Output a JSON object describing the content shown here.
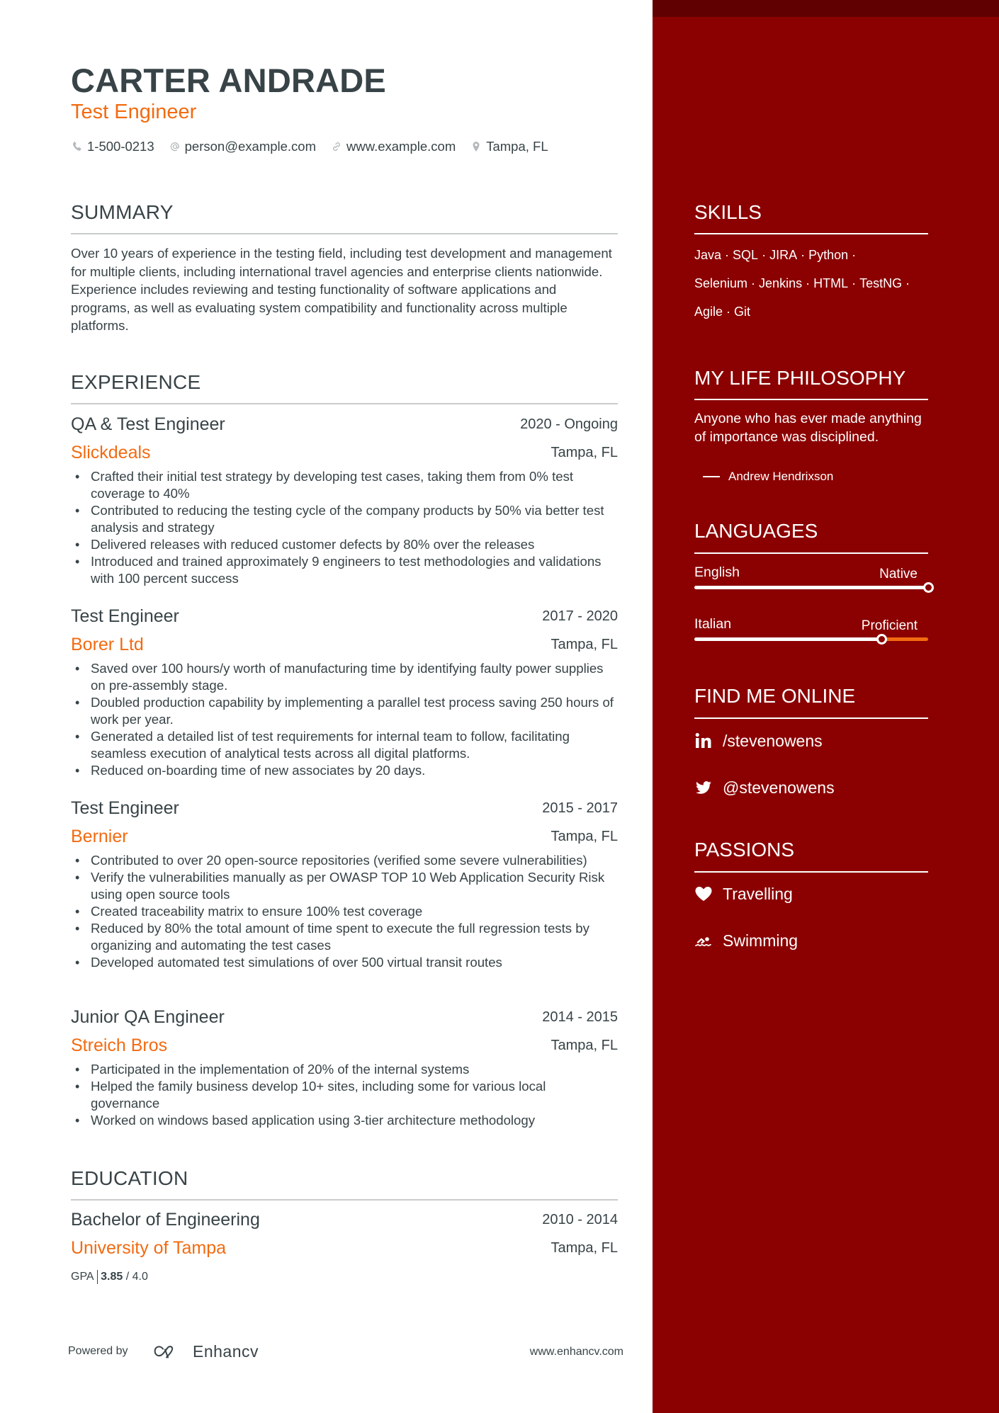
{
  "header": {
    "name": "CARTER ANDRADE",
    "title": "Test Engineer",
    "contacts": [
      {
        "icon": "phone-icon",
        "text": "1-500-0213"
      },
      {
        "icon": "at-icon",
        "text": "person@example.com"
      },
      {
        "icon": "link-icon",
        "text": "www.example.com"
      },
      {
        "icon": "location-pin-icon",
        "text": "Tampa, FL"
      }
    ]
  },
  "summary": {
    "heading": "SUMMARY",
    "text": "Over 10 years of experience in the testing field, including test development and management for multiple clients, including international travel agencies and enterprise clients nationwide. Experience includes reviewing and testing functionality of software applications and programs, as well as evaluating system compatibility and functionality across multiple platforms."
  },
  "experience": {
    "heading": "EXPERIENCE",
    "jobs": [
      {
        "role": "QA & Test Engineer",
        "dates": "2020 - Ongoing",
        "company": "Slickdeals",
        "location": "Tampa, FL",
        "bullets": [
          "Crafted their initial test strategy by developing test cases, taking them from 0% test coverage to 40%",
          "Contributed to reducing the testing cycle of the company products by 50% via better test analysis and strategy",
          "Delivered releases with reduced customer defects by 80% over the releases",
          "Introduced and trained approximately 9 engineers to test methodologies and validations with 100 percent success"
        ]
      },
      {
        "role": "Test Engineer",
        "dates": "2017 - 2020",
        "company": "Borer Ltd",
        "location": "Tampa, FL",
        "bullets": [
          "Saved over 100 hours/y worth of manufacturing time by identifying faulty power supplies on pre-assembly stage.",
          "Doubled production capability by implementing a parallel test process saving 250 hours of work per year.",
          "Generated a detailed list of test requirements for internal team to follow, facilitating seamless execution of analytical tests across all digital platforms.",
          "Reduced on-boarding time of new associates by 20 days."
        ]
      },
      {
        "role": "Test Engineer",
        "dates": "2015 - 2017",
        "company": "Bernier",
        "location": "Tampa, FL",
        "bullets": [
          "Contributed to over 20 open-source repositories (verified some severe vulnerabilities)",
          "Verify the vulnerabilities manually as per OWASP TOP 10 Web Application Security Risk using open source tools",
          "Created traceability matrix to ensure 100% test coverage",
          "Reduced by 80% the total amount of time spent to execute the full regression tests by organizing and automating the test cases",
          "Developed automated test simulations of over 500 virtual transit routes"
        ]
      },
      {
        "role": "Junior QA Engineer",
        "dates": "2014 - 2015",
        "company": "Streich Bros",
        "location": "Tampa, FL",
        "bullets": [
          "Participated in the implementation of 20% of the internal systems",
          "Helped the family business develop 10+ sites, including some for various local governance",
          "Worked on windows based application using 3-tier architecture methodology"
        ]
      }
    ]
  },
  "education": {
    "heading": "EDUCATION",
    "degree": "Bachelor of Engineering",
    "dates": "2010 - 2014",
    "school": "University of Tampa",
    "location": "Tampa, FL",
    "gpa_label": "GPA",
    "gpa_value": "3.85",
    "gpa_max": "/ 4.0"
  },
  "footer": {
    "powered_by": "Powered by",
    "brand": "Enhancv",
    "site": "www.enhancv.com"
  },
  "sidebar": {
    "skills": {
      "heading": "SKILLS",
      "items": [
        "Java",
        "SQL",
        "JIRA",
        "Python",
        "Selenium",
        "Jenkins",
        "HTML",
        "TestNG",
        "Agile",
        "Git"
      ]
    },
    "philosophy": {
      "heading": "MY LIFE PHILOSOPHY",
      "quote": "Anyone who has ever made anything of importance was disciplined.",
      "author": "Andrew Hendrixson"
    },
    "languages": {
      "heading": "LANGUAGES",
      "items": [
        {
          "name": "English",
          "level": "Native",
          "proficiency": 1.0
        },
        {
          "name": "Italian",
          "level": "Proficient",
          "proficiency": 0.8
        }
      ]
    },
    "online": {
      "heading": "FIND ME ONLINE",
      "items": [
        {
          "icon": "linkedin-icon",
          "text": "/stevenowens"
        },
        {
          "icon": "twitter-icon",
          "text": "@stevenowens"
        }
      ]
    },
    "passions": {
      "heading": "PASSIONS",
      "items": [
        {
          "icon": "heart-icon",
          "text": "Travelling"
        },
        {
          "icon": "swimming-icon",
          "text": "Swimming"
        }
      ]
    }
  },
  "colors": {
    "accent": "#f26b11",
    "sidebar_bg": "#8b0000",
    "sidebar_band": "#610000",
    "text": "#384347"
  }
}
